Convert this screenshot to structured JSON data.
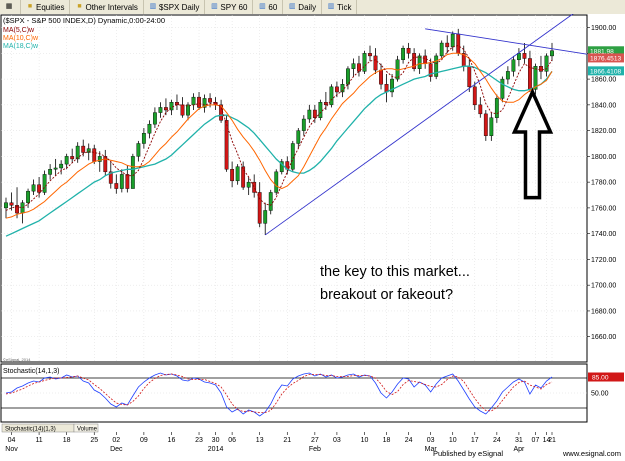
{
  "toolbar": {
    "items": [
      {
        "label": "",
        "icon": "layout-icon"
      },
      {
        "label": "Equities",
        "icon": "folder-icon"
      },
      {
        "label": "Other Intervals",
        "icon": "folder-icon"
      },
      {
        "label": "$SPX Daily",
        "icon": "chart-icon"
      },
      {
        "label": "SPY 60",
        "icon": "chart-icon"
      },
      {
        "label": "60",
        "icon": "chart-icon"
      },
      {
        "label": "Daily",
        "icon": "chart-icon"
      },
      {
        "label": "Tick",
        "icon": "chart-icon"
      }
    ]
  },
  "chart_data": {
    "type": "candlestick",
    "title": "($SPX - S&P 500 INDEX,D) Dynamic,0:00-24:00",
    "legend": [
      {
        "label": "MA(5,C)w",
        "color": "#8b0000"
      },
      {
        "label": "MA(10,C)w",
        "color": "#ff6600"
      },
      {
        "label": "MA(18,C)w",
        "color": "#20b2aa"
      }
    ],
    "y_ticks": [
      1900,
      1880,
      1860,
      1840,
      1820,
      1800,
      1780,
      1760,
      1740,
      1720,
      1700,
      1680,
      1660
    ],
    "ylim": [
      1645,
      1910
    ],
    "price_labels": [
      {
        "text": "1881.98",
        "value": 1881.98,
        "color": "#2ea043"
      },
      {
        "text": "1876.4513",
        "value": 1876.45,
        "color": "#d9534f"
      },
      {
        "text": "1866.4108",
        "value": 1866.41,
        "color": "#20b2aa"
      }
    ],
    "annotation_lines": [
      "the key to this market...",
      "breakout or fakeout?"
    ],
    "watermark_top": "©eSignal, 2014",
    "candles": [
      [
        1760,
        1768,
        1752,
        1764
      ],
      [
        1764,
        1772,
        1758,
        1762
      ],
      [
        1762,
        1776,
        1752,
        1756
      ],
      [
        1756,
        1766,
        1748,
        1764
      ],
      [
        1764,
        1775,
        1760,
        1773
      ],
      [
        1773,
        1782,
        1770,
        1778
      ],
      [
        1778,
        1784,
        1768,
        1772
      ],
      [
        1772,
        1789,
        1770,
        1786
      ],
      [
        1786,
        1794,
        1782,
        1790
      ],
      [
        1790,
        1798,
        1785,
        1791
      ],
      [
        1791,
        1797,
        1786,
        1794
      ],
      [
        1794,
        1802,
        1790,
        1800
      ],
      [
        1800,
        1806,
        1795,
        1798
      ],
      [
        1798,
        1811,
        1795,
        1808
      ],
      [
        1808,
        1813,
        1800,
        1803
      ],
      [
        1803,
        1810,
        1797,
        1806
      ],
      [
        1806,
        1809,
        1794,
        1796
      ],
      [
        1796,
        1804,
        1788,
        1800
      ],
      [
        1800,
        1805,
        1785,
        1788
      ],
      [
        1788,
        1796,
        1775,
        1779
      ],
      [
        1779,
        1786,
        1771,
        1775
      ],
      [
        1775,
        1790,
        1772,
        1786
      ],
      [
        1786,
        1793,
        1772,
        1775
      ],
      [
        1775,
        1802,
        1775,
        1800
      ],
      [
        1800,
        1812,
        1796,
        1810
      ],
      [
        1810,
        1822,
        1806,
        1818
      ],
      [
        1818,
        1828,
        1814,
        1825
      ],
      [
        1825,
        1838,
        1822,
        1834
      ],
      [
        1834,
        1842,
        1830,
        1838
      ],
      [
        1838,
        1845,
        1832,
        1836
      ],
      [
        1836,
        1844,
        1832,
        1842
      ],
      [
        1842,
        1848,
        1836,
        1840
      ],
      [
        1840,
        1846,
        1830,
        1832
      ],
      [
        1832,
        1842,
        1828,
        1840
      ],
      [
        1840,
        1849,
        1836,
        1846
      ],
      [
        1846,
        1850,
        1836,
        1838
      ],
      [
        1838,
        1848,
        1834,
        1845
      ],
      [
        1845,
        1849,
        1838,
        1842
      ],
      [
        1842,
        1846,
        1836,
        1840
      ],
      [
        1840,
        1844,
        1826,
        1828
      ],
      [
        1828,
        1832,
        1788,
        1790
      ],
      [
        1790,
        1796,
        1776,
        1781
      ],
      [
        1781,
        1794,
        1778,
        1792
      ],
      [
        1792,
        1796,
        1774,
        1776
      ],
      [
        1776,
        1784,
        1770,
        1780
      ],
      [
        1780,
        1786,
        1768,
        1772
      ],
      [
        1772,
        1780,
        1745,
        1748
      ],
      [
        1748,
        1764,
        1739,
        1758
      ],
      [
        1758,
        1774,
        1755,
        1772
      ],
      [
        1772,
        1790,
        1770,
        1788
      ],
      [
        1788,
        1798,
        1786,
        1796
      ],
      [
        1796,
        1800,
        1786,
        1790
      ],
      [
        1790,
        1812,
        1788,
        1810
      ],
      [
        1810,
        1822,
        1806,
        1820
      ],
      [
        1820,
        1832,
        1816,
        1829
      ],
      [
        1829,
        1840,
        1826,
        1836
      ],
      [
        1836,
        1840,
        1826,
        1830
      ],
      [
        1830,
        1844,
        1828,
        1842
      ],
      [
        1842,
        1850,
        1836,
        1840
      ],
      [
        1840,
        1856,
        1838,
        1854
      ],
      [
        1854,
        1858,
        1846,
        1850
      ],
      [
        1850,
        1860,
        1846,
        1856
      ],
      [
        1856,
        1870,
        1852,
        1868
      ],
      [
        1868,
        1876,
        1862,
        1872
      ],
      [
        1872,
        1878,
        1862,
        1866
      ],
      [
        1866,
        1882,
        1864,
        1880
      ],
      [
        1880,
        1886,
        1874,
        1878
      ],
      [
        1878,
        1884,
        1864,
        1867
      ],
      [
        1867,
        1872,
        1852,
        1856
      ],
      [
        1856,
        1864,
        1842,
        1850
      ],
      [
        1850,
        1864,
        1846,
        1860
      ],
      [
        1860,
        1878,
        1858,
        1875
      ],
      [
        1875,
        1886,
        1872,
        1884
      ],
      [
        1884,
        1888,
        1876,
        1880
      ],
      [
        1880,
        1884,
        1866,
        1868
      ],
      [
        1868,
        1880,
        1864,
        1878
      ],
      [
        1878,
        1883,
        1868,
        1872
      ],
      [
        1872,
        1876,
        1858,
        1862
      ],
      [
        1862,
        1880,
        1860,
        1878
      ],
      [
        1878,
        1890,
        1876,
        1888
      ],
      [
        1888,
        1894,
        1880,
        1885
      ],
      [
        1885,
        1897,
        1882,
        1895
      ],
      [
        1895,
        1899,
        1878,
        1880
      ],
      [
        1880,
        1886,
        1866,
        1870
      ],
      [
        1870,
        1876,
        1850,
        1854
      ],
      [
        1854,
        1858,
        1836,
        1840
      ],
      [
        1840,
        1846,
        1830,
        1833
      ],
      [
        1833,
        1836,
        1812,
        1816
      ],
      [
        1816,
        1834,
        1812,
        1830
      ],
      [
        1830,
        1848,
        1826,
        1845
      ],
      [
        1845,
        1862,
        1842,
        1860
      ],
      [
        1860,
        1870,
        1856,
        1866
      ],
      [
        1866,
        1878,
        1862,
        1875
      ],
      [
        1875,
        1884,
        1870,
        1880
      ],
      [
        1880,
        1888,
        1872,
        1876
      ],
      [
        1876,
        1882,
        1850,
        1852
      ],
      [
        1852,
        1872,
        1848,
        1870
      ],
      [
        1870,
        1878,
        1860,
        1866
      ],
      [
        1866,
        1880,
        1862,
        1878
      ],
      [
        1878,
        1888,
        1874,
        1882
      ]
    ],
    "ma": {
      "ma5": [
        1758,
        1760,
        1761,
        1760,
        1763,
        1767,
        1771,
        1776,
        1781,
        1785,
        1789,
        1791,
        1795,
        1799,
        1802,
        1804,
        1803,
        1802,
        1800,
        1796,
        1791,
        1788,
        1785,
        1785,
        1789,
        1798,
        1808,
        1818,
        1827,
        1834,
        1838,
        1840,
        1840,
        1839,
        1840,
        1841,
        1840,
        1841,
        1842,
        1838,
        1825,
        1812,
        1802,
        1790,
        1784,
        1776,
        1767,
        1763,
        1762,
        1768,
        1778,
        1788,
        1798,
        1806,
        1815,
        1823,
        1829,
        1834,
        1838,
        1844,
        1848,
        1851,
        1856,
        1862,
        1866,
        1870,
        1874,
        1875,
        1871,
        1866,
        1862,
        1861,
        1865,
        1873,
        1877,
        1877,
        1876,
        1874,
        1872,
        1875,
        1881,
        1885,
        1886,
        1883,
        1876,
        1866,
        1855,
        1841,
        1834,
        1833,
        1836,
        1845,
        1855,
        1865,
        1872,
        1869,
        1868,
        1867,
        1868,
        1875
      ],
      "ma10": [
        1752,
        1753,
        1755,
        1756,
        1757,
        1759,
        1762,
        1765,
        1769,
        1773,
        1777,
        1780,
        1784,
        1788,
        1791,
        1794,
        1796,
        1797,
        1798,
        1797,
        1796,
        1795,
        1793,
        1792,
        1792,
        1793,
        1796,
        1801,
        1806,
        1810,
        1815,
        1819,
        1824,
        1829,
        1833,
        1837,
        1839,
        1840,
        1840,
        1839,
        1834,
        1828,
        1821,
        1815,
        1810,
        1804,
        1797,
        1789,
        1782,
        1777,
        1775,
        1777,
        1781,
        1785,
        1792,
        1800,
        1808,
        1816,
        1822,
        1829,
        1835,
        1841,
        1845,
        1849,
        1854,
        1858,
        1862,
        1865,
        1867,
        1868,
        1868,
        1867,
        1868,
        1869,
        1870,
        1872,
        1872,
        1873,
        1874,
        1876,
        1879,
        1880,
        1880,
        1879,
        1876,
        1872,
        1866,
        1860,
        1853,
        1847,
        1843,
        1842,
        1842,
        1844,
        1848,
        1851,
        1854,
        1856,
        1859,
        1866
      ],
      "ma18": [
        1738,
        1740,
        1742,
        1744,
        1746,
        1748,
        1750,
        1753,
        1756,
        1759,
        1762,
        1765,
        1768,
        1771,
        1774,
        1777,
        1780,
        1782,
        1785,
        1787,
        1788,
        1789,
        1790,
        1790,
        1791,
        1792,
        1793,
        1794,
        1796,
        1798,
        1801,
        1805,
        1809,
        1813,
        1817,
        1821,
        1825,
        1828,
        1831,
        1832,
        1832,
        1830,
        1828,
        1825,
        1822,
        1818,
        1813,
        1808,
        1803,
        1798,
        1794,
        1790,
        1788,
        1787,
        1787,
        1789,
        1792,
        1796,
        1801,
        1806,
        1812,
        1817,
        1822,
        1827,
        1832,
        1837,
        1841,
        1845,
        1848,
        1850,
        1852,
        1854,
        1856,
        1858,
        1860,
        1861,
        1862,
        1864,
        1865,
        1866,
        1867,
        1868,
        1869,
        1870,
        1870,
        1869,
        1867,
        1865,
        1862,
        1859,
        1856,
        1854,
        1852,
        1851,
        1851,
        1852,
        1854,
        1856,
        1860,
        1866
      ]
    },
    "trendlines": [
      {
        "from": [
          47,
          1739
        ],
        "to": [
          95,
          1885
        ],
        "color": "#3333cc"
      },
      {
        "from": [
          76,
          1899
        ],
        "to": [
          105,
          1880
        ],
        "color": "#3333cc"
      }
    ],
    "arrow": {
      "x_index": 98,
      "top_value": 1850,
      "bottom_value": 1768
    },
    "stochastic": {
      "label": "Stochastic(14,1,3)",
      "label_with_values": "Stochastic(14)(1,3)",
      "y_ticks": [
        50
      ],
      "levels": [
        80,
        20
      ],
      "last_value_label": "85.00",
      "k": [
        50,
        52,
        60,
        64,
        70,
        74,
        72,
        80,
        82,
        78,
        80,
        86,
        82,
        84,
        74,
        70,
        56,
        50,
        40,
        28,
        22,
        30,
        26,
        44,
        62,
        72,
        80,
        86,
        90,
        86,
        88,
        84,
        76,
        74,
        80,
        78,
        72,
        70,
        66,
        50,
        22,
        12,
        18,
        8,
        16,
        12,
        4,
        12,
        28,
        50,
        66,
        64,
        78,
        84,
        88,
        90,
        84,
        88,
        82,
        86,
        80,
        82,
        86,
        88,
        82,
        86,
        84,
        70,
        50,
        40,
        52,
        68,
        80,
        78,
        62,
        72,
        66,
        52,
        68,
        80,
        84,
        88,
        74,
        56,
        38,
        22,
        14,
        8,
        20,
        34,
        52,
        62,
        72,
        78,
        72,
        48,
        66,
        60,
        74,
        82
      ],
      "d": [
        48,
        50,
        54,
        58,
        64,
        69,
        72,
        75,
        78,
        80,
        80,
        81,
        82,
        84,
        80,
        76,
        67,
        59,
        49,
        39,
        30,
        27,
        26,
        33,
        44,
        59,
        71,
        79,
        85,
        87,
        88,
        86,
        83,
        78,
        77,
        77,
        77,
        73,
        69,
        62,
        46,
        28,
        17,
        13,
        14,
        12,
        11,
        11,
        15,
        30,
        48,
        60,
        69,
        75,
        83,
        87,
        87,
        87,
        85,
        85,
        83,
        83,
        83,
        85,
        85,
        85,
        84,
        80,
        68,
        53,
        47,
        53,
        67,
        75,
        73,
        71,
        67,
        63,
        62,
        67,
        77,
        84,
        82,
        73,
        56,
        39,
        25,
        15,
        14,
        21,
        35,
        49,
        62,
        71,
        74,
        66,
        62,
        58,
        67,
        72
      ]
    },
    "x_labels": [
      {
        "i": 1,
        "text": "04"
      },
      {
        "i": 6,
        "text": "11"
      },
      {
        "i": 11,
        "text": "18"
      },
      {
        "i": 16,
        "text": "25"
      },
      {
        "i": 20,
        "text": "02"
      },
      {
        "i": 25,
        "text": "09"
      },
      {
        "i": 30,
        "text": "16"
      },
      {
        "i": 35,
        "text": "23"
      },
      {
        "i": 38,
        "text": "30"
      },
      {
        "i": 41,
        "text": "06"
      },
      {
        "i": 46,
        "text": "13"
      },
      {
        "i": 51,
        "text": "21"
      },
      {
        "i": 56,
        "text": "27"
      },
      {
        "i": 60,
        "text": "03"
      },
      {
        "i": 65,
        "text": "10"
      },
      {
        "i": 69,
        "text": "18"
      },
      {
        "i": 73,
        "text": "24"
      },
      {
        "i": 77,
        "text": "03"
      },
      {
        "i": 81,
        "text": "10"
      },
      {
        "i": 85,
        "text": "17"
      },
      {
        "i": 89,
        "text": "24"
      },
      {
        "i": 93,
        "text": "31"
      },
      {
        "i": 96,
        "text": "07"
      },
      {
        "i": 98,
        "text": "14"
      },
      {
        "i": 99,
        "text": "21"
      }
    ],
    "month_labels": [
      {
        "i": 1,
        "text": "Nov"
      },
      {
        "i": 20,
        "text": "Dec"
      },
      {
        "i": 38,
        "text": "2014"
      },
      {
        "i": 56,
        "text": "Feb"
      },
      {
        "i": 77,
        "text": "Mar"
      },
      {
        "i": 93,
        "text": "Apr"
      }
    ],
    "tabs": [
      "Stochastic(14)(1,3)",
      "Volume"
    ],
    "footer": "Published by eSignal",
    "footer_url": "www.esignal.com"
  }
}
